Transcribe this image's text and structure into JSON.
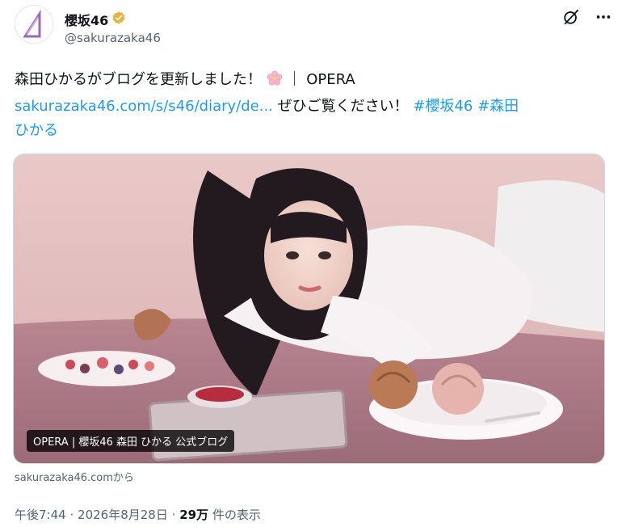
{
  "author": {
    "display_name": "櫻坂46",
    "handle": "@sakurazaka46",
    "verified_badge_icon": "gold-verified-badge-icon"
  },
  "actions": {
    "grok_icon": "grok-icon",
    "more_icon": "more-options-icon"
  },
  "tweet": {
    "text_line1": "森田ひかるがブログを更新しました！",
    "emoji": "cherry-blossom",
    "text_line1_suffix": "｜ OPERA",
    "link": "sakurazaka46.com/s/s46/diary/de...",
    "text_line2_mid": " ぜひご覧ください！ ",
    "hashtag1": "#櫻坂46",
    "hashtag2_part1": "#森田",
    "hashtag2_part2": "ひかる"
  },
  "card": {
    "caption": "OPERA | 櫻坂46 森田 ひかる 公式ブログ",
    "source": "sakurazaka46.comから"
  },
  "meta": {
    "time": "午後7:44",
    "separator": "·",
    "date": "2026年8月28日",
    "views_count": "29万",
    "views_label": " 件の表示"
  },
  "colors": {
    "link": "#1d9bf0",
    "text": "#0f1419",
    "secondary": "#536471",
    "badge": "#e8b339",
    "brand_purple": "#9b6bb5"
  }
}
